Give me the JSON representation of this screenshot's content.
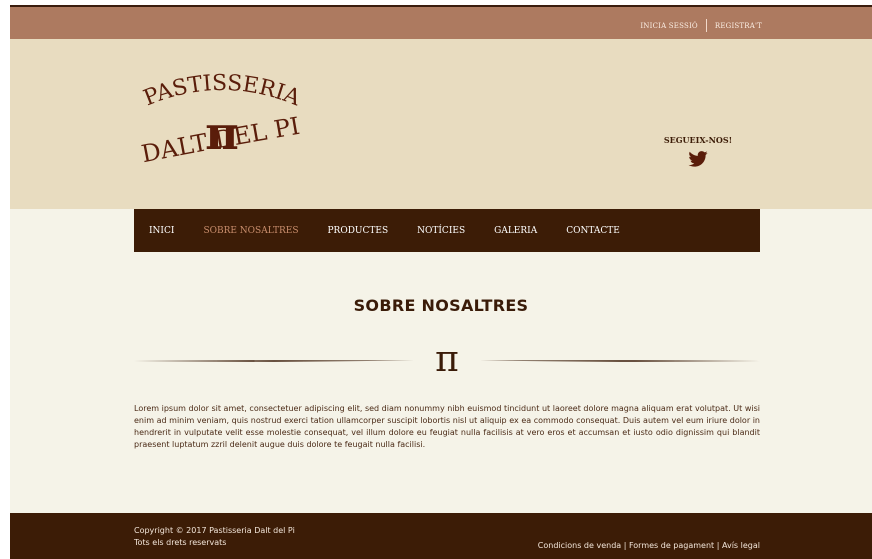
{
  "topbar": {
    "login": "INICIA SESSIÓ",
    "register": "REGISTRA'T"
  },
  "logo": {
    "line1": "PASTISSERIA",
    "symbol": "π",
    "line2": "DALT DEL PI"
  },
  "social": {
    "label": "SEGUEIX-NOS!",
    "icon": "twitter-icon"
  },
  "nav": {
    "items": [
      "INICI",
      "SOBRE NOSALTRES",
      "PRODUCTES",
      "NOTÍCIES",
      "GALERIA",
      "CONTACTE"
    ],
    "active_index": 1
  },
  "main": {
    "title": "SOBRE NOSALTRES",
    "divider_symbol": "π",
    "paragraph": "Lorem ipsum dolor sit amet, consectetuer adipiscing elit, sed diam nonummy nibh euismod tincidunt ut laoreet dolore magna aliquam erat volutpat. Ut wisi enim ad minim veniam, quis nostrud exerci tation ullamcorper suscipit lobortis nisl ut aliquip ex ea commodo consequat. Duis autem vel eum iriure dolor in hendrerit in vulputate velit esse molestie consequat, vel illum dolore eu feugiat nulla facilisis at vero eros et accumsan et iusto odio dignissim qui blandit praesent luptatum zzril delenit augue duis dolore te feugait nulla facilisi."
  },
  "footer": {
    "copyright": "Copyright © 2017 Pastisseria Dalt del Pi",
    "rights": "Tots els drets reservats",
    "links": [
      "Condicions de venda",
      "Formes de pagament",
      "Avís legal"
    ],
    "separator": " | "
  },
  "colors": {
    "topbar": "#ad7a60",
    "header": "#e8dcc0",
    "nav": "#3c1c06",
    "nav_active": "#c88d6c",
    "page_bg": "#f5f3e8",
    "brand_dark": "#5a1d0a",
    "footer": "#3c1c06"
  }
}
